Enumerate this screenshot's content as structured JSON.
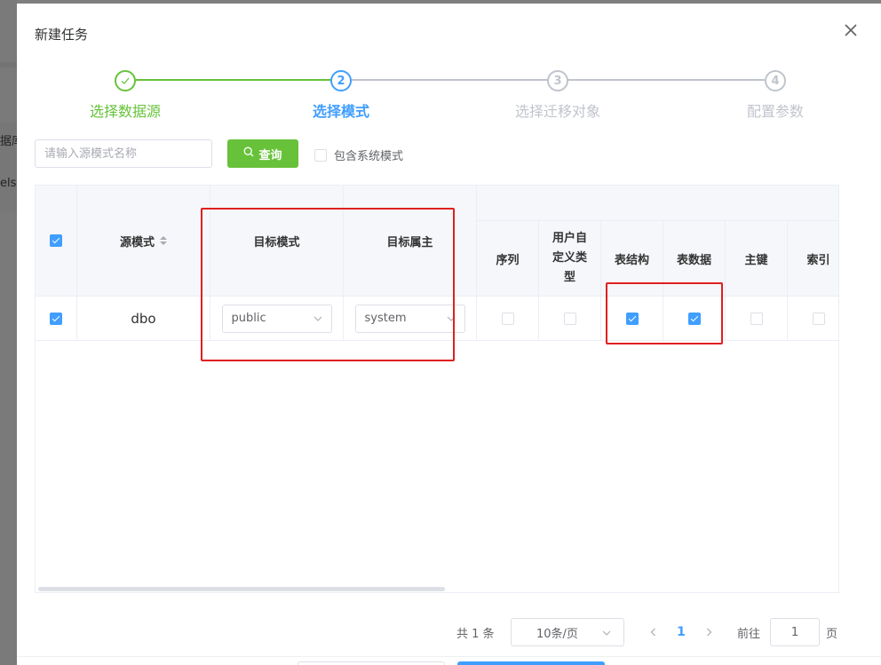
{
  "background": {
    "fragments": [
      "据库",
      "else"
    ]
  },
  "dialog": {
    "title": "新建任务"
  },
  "steps": [
    {
      "index": "1",
      "title": "选择数据源",
      "status": "finish"
    },
    {
      "index": "2",
      "title": "选择模式",
      "status": "process"
    },
    {
      "index": "3",
      "title": "选择迁移对象",
      "status": "wait"
    },
    {
      "index": "4",
      "title": "配置参数",
      "status": "wait"
    }
  ],
  "toolbar": {
    "search_placeholder": "请输入源模式名称",
    "query_label": "查询",
    "include_system_label": "包含系统模式",
    "include_system_checked": false
  },
  "table": {
    "headers": {
      "source_schema": "源模式",
      "target_schema": "目标模式",
      "target_owner": "目标属主",
      "sequence": "序列",
      "user_type": "用户自定义类型",
      "table_structure": "表结构",
      "table_data": "表数据",
      "primary_key": "主键",
      "index": "索引"
    },
    "header_all_checked": true,
    "rows": [
      {
        "checked": true,
        "source_schema": "dbo",
        "target_schema": "public",
        "target_owner": "system",
        "sequence": false,
        "user_type": false,
        "table_structure": true,
        "table_data": true,
        "primary_key": false,
        "index": false
      }
    ]
  },
  "pagination": {
    "total": "共 1 条",
    "page_size": "10条/页",
    "current_page": "1",
    "goto_label": "前往",
    "goto_value": "1",
    "page_suffix": "页"
  },
  "colors": {
    "success": "#67c23a",
    "primary": "#409eff",
    "highlight": "#e02020"
  }
}
